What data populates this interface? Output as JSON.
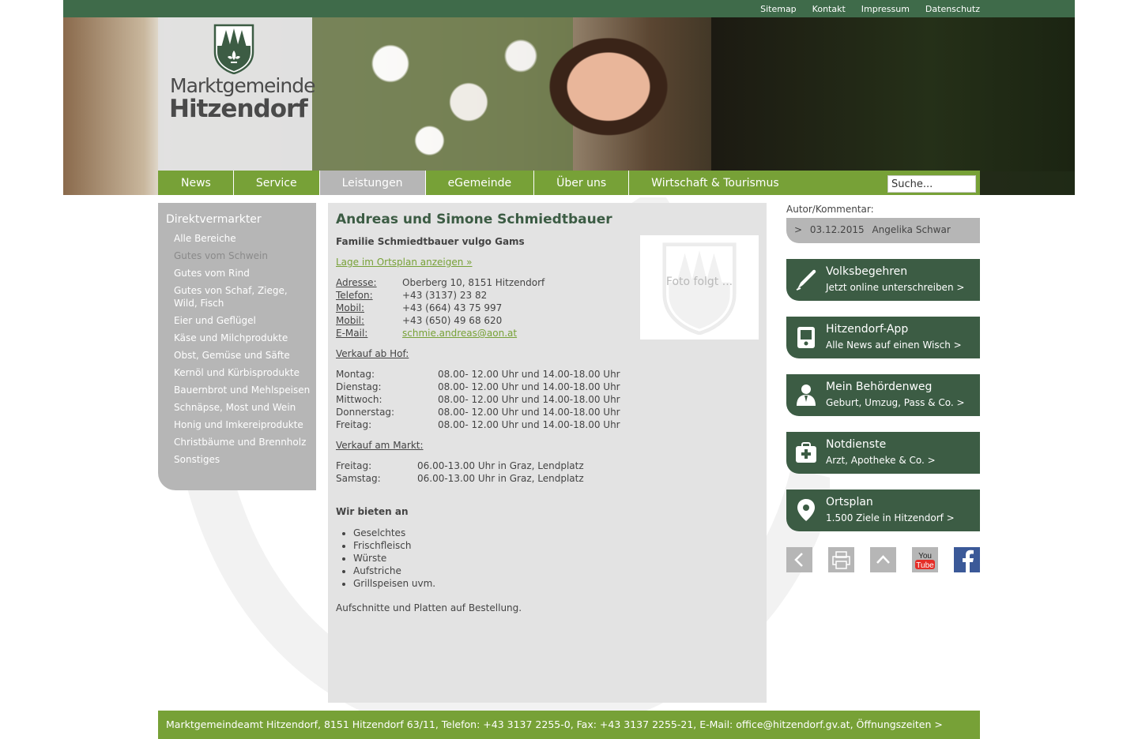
{
  "top_links": [
    "Sitemap",
    "Kontakt",
    "Impressum",
    "Datenschutz"
  ],
  "logo": {
    "line1": "Marktgemeinde",
    "line2": "Hitzendorf"
  },
  "nav": {
    "items": [
      "News",
      "Service",
      "Leistungen",
      "eGemeinde",
      "Über uns",
      "Wirtschaft & Tourismus"
    ],
    "active": "Leistungen",
    "search_value": "Suche..."
  },
  "sidebar": {
    "title": "Direktvermarkter",
    "items": [
      "Alle Bereiche",
      "Gutes vom Schwein",
      "Gutes vom Rind",
      "Gutes von Schaf, Ziege, Wild, Fisch",
      "Eier und Geflügel",
      "Käse und Milchprodukte",
      "Obst, Gemüse und Säfte",
      "Kernöl und Kürbisprodukte",
      "Bauernbrot und Mehlspeisen",
      "Schnäpse, Most und Wein",
      "Honig und Imkereiprodukte",
      "Christbäume und Brennholz",
      "Sonstiges"
    ],
    "current": "Gutes vom Schwein"
  },
  "main": {
    "title": "Andreas und Simone Schmiedtbauer",
    "subtitle": "Familie Schmiedtbauer vulgo Gams",
    "map_link": "Lage im Ortsplan anzeigen »",
    "photo_placeholder": "Foto folgt ...",
    "contact": [
      {
        "label": "Adresse:",
        "value": "Oberberg 10, 8151 Hitzendorf"
      },
      {
        "label": "Telefon:",
        "value": "+43 (3137) 23 82"
      },
      {
        "label": "Mobil:",
        "value": "+43 (664) 43 75 997"
      },
      {
        "label": "Mobil:",
        "value": "+43 (650) 49 68 620"
      },
      {
        "label": "E-Mail:",
        "value": "schmie.andreas@aon.at"
      }
    ],
    "farm_sale_title": "Verkauf ab Hof:",
    "farm_hours": [
      {
        "day": "Montag:",
        "time": "08.00- 12.00 Uhr und 14.00-18.00 Uhr"
      },
      {
        "day": "Dienstag:",
        "time": "08.00- 12.00 Uhr und 14.00-18.00 Uhr"
      },
      {
        "day": "Mittwoch:",
        "time": "08.00- 12.00 Uhr und 14.00-18.00 Uhr"
      },
      {
        "day": "Donnerstag:",
        "time": "08.00- 12.00 Uhr und 14.00-18.00 Uhr"
      },
      {
        "day": "Freitag:",
        "time": "08.00- 12.00 Uhr und 14.00-18.00 Uhr"
      }
    ],
    "market_sale_title": "Verkauf am Markt:",
    "market_hours": [
      {
        "day": "Freitag:",
        "time": "06.00-13.00 Uhr in Graz, Lendplatz"
      },
      {
        "day": "Samstag:",
        "time": "06.00-13.00 Uhr in Graz, Lendplatz"
      }
    ],
    "offer_title": "Wir bieten an",
    "offers": [
      "Geselchtes",
      "Frischfleisch",
      "Würste",
      "Aufstriche",
      "Grillspeisen uvm."
    ],
    "offer_note": "Aufschnitte und Platten auf Bestellung."
  },
  "author": {
    "label": "Autor/Kommentar:",
    "marker": ">",
    "date": "03.12.2015",
    "name": "Angelika Schwar"
  },
  "services": [
    {
      "title": "Volksbegehren",
      "subtitle": "Jetzt online unterschreiben >",
      "icon": "pen-icon"
    },
    {
      "title": "Hitzendorf-App",
      "subtitle": "Alle News auf einen Wisch >",
      "icon": "phone-icon"
    },
    {
      "title": "Mein Behördenweg",
      "subtitle": "Geburt, Umzug, Pass & Co. >",
      "icon": "person-icon"
    },
    {
      "title": "Notdienste",
      "subtitle": "Arzt, Apotheke & Co. >",
      "icon": "first-aid-icon"
    },
    {
      "title": "Ortsplan",
      "subtitle": "1.500 Ziele in Hitzendorf >",
      "icon": "map-pin-icon"
    }
  ],
  "social": {
    "youtube_you": "You",
    "youtube_tube": "Tube"
  },
  "footer": "Marktgemeindeamt Hitzendorf, 8151 Hitzendorf 63/11, Telefon: +43 3137 2255-0, Fax: +43 3137 2255-21, E-Mail: office@hitzendorf.gv.at, Öffnungszeiten >",
  "colors": {
    "dark_green": "#3c5c44",
    "light_green": "#77a137",
    "gray": "#b6b6b6"
  }
}
